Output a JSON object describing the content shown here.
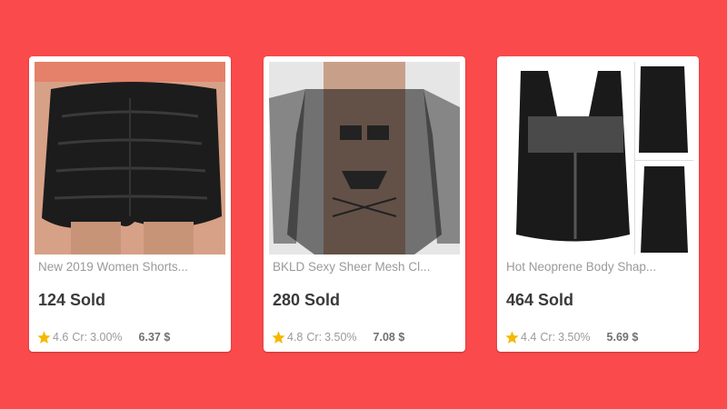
{
  "theme": {
    "background": "#fb4a4c",
    "card": "#ffffff",
    "star": "#f5b800"
  },
  "products": [
    {
      "title": "New 2019 Women Shorts...",
      "sold": "124 Sold",
      "rating": "4.6",
      "cr_label": "Cr:",
      "cr_value": "3.00%",
      "price": "6.37 $",
      "icon": "star-icon"
    },
    {
      "title": "BKLD Sexy Sheer Mesh Cl...",
      "sold": "280 Sold",
      "rating": "4.8",
      "cr_label": "Cr:",
      "cr_value": "3.50%",
      "price": "7.08 $",
      "icon": "star-icon"
    },
    {
      "title": "Hot Neoprene Body Shap...",
      "sold": "464 Sold",
      "rating": "4.4",
      "cr_label": "Cr:",
      "cr_value": "3.50%",
      "price": "5.69 $",
      "icon": "star-icon"
    }
  ]
}
